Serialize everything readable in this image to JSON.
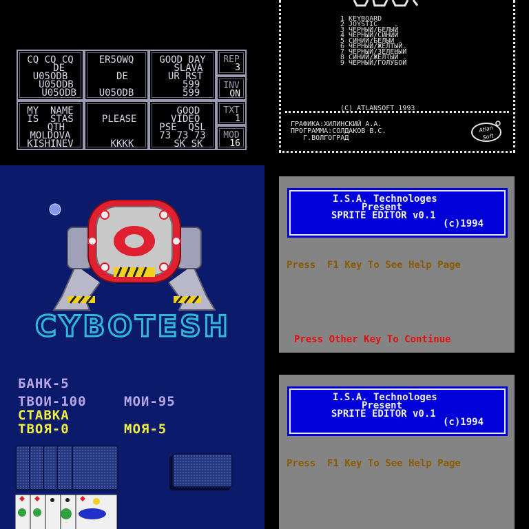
{
  "cw_panel": {
    "cells": [
      {
        "id": "cq",
        "lines": "CQ CQ CQ\n   DE\nU05ODB\n  U05ODB\n   U05ODB"
      },
      {
        "id": "call",
        "lines": "ER5OWQ\n\n  DE\n\nU05ODB"
      },
      {
        "id": "greet",
        "lines": "GOOD DAY\n  SLAVA\n UR RST\n   599\n   599"
      },
      {
        "id": "name",
        "lines": "MY  NAME\nIS  STAS\n  QTH\nMOLDOVA\nKISHINEV"
      },
      {
        "id": "please",
        "lines": "\n PLEASE\n\n\n  KKKK"
      },
      {
        "id": "video",
        "lines": "  GOOD\n VIDEO\nPSE  QSL\n73 73 73\n  SK SK"
      }
    ],
    "side": [
      {
        "label": "REP",
        "value": "3"
      },
      {
        "label": "INV",
        "value": "ON"
      },
      {
        "label": "TXT",
        "value": "1"
      },
      {
        "label": "MOD",
        "value": "16"
      }
    ]
  },
  "atlansoft_panel": {
    "menu": "1 KEYBOARD\n2 JOYSTIC\n3 ЧЕРНЫЙ/БЕЛЫЙ\n4 ЧЕРНЫЙ/СИНИЙ\n5 СИНИЙ/БЕЛЫЙ\n6 ЧЕРНЫЙ/ЖЕЛТЫЙ\n7 ЧЕРНЫЙ/ЗЕЛЕНЫЙ\n8 СИНИЙ/ЖЕЛТЫЙ\n9 ЧЕРНЫЙ/ГОЛУБОЙ",
    "copyright": "(C) ATLANSOFT 1993",
    "credits": "ГРАФИКА:ХИЛИНСКИЙ А.А.\nПРОГРАММА:СОЛДАКОВ В.С.\n   Г.ВОЛГОГРАД",
    "logo_text": "AtlanSoft"
  },
  "cybotesh_panel": {
    "title": "CYBOTESH",
    "bank": "БАНК-5",
    "yours": "ТВОИ-100",
    "mine": "МОИ-95",
    "stake_label": "СТАВКА",
    "your_stake": "ТВОЯ-0",
    "my_stake": "МОЯ-5",
    "colors": {
      "bg": "#0c1a6c",
      "purple": "#b8a8e8",
      "yellow": "#f0f040",
      "cyan": "#30b8d8"
    }
  },
  "sprite_editor": [
    {
      "title_l1": "I.S.A. Technologes",
      "title_l2": "Present",
      "title_l3": "SPRITE EDITOR v0.1",
      "title_l4": "(c)1994",
      "help": "Press  F1 Key To See Help Page",
      "continue": "Press Other Key To Continue"
    },
    {
      "title_l1": "I.S.A. Technologes",
      "title_l2": "Present",
      "title_l3": "SPRITE EDITOR v0.1",
      "title_l4": "(c)1994",
      "help": "Press  F1 Key To See Help Page"
    }
  ]
}
